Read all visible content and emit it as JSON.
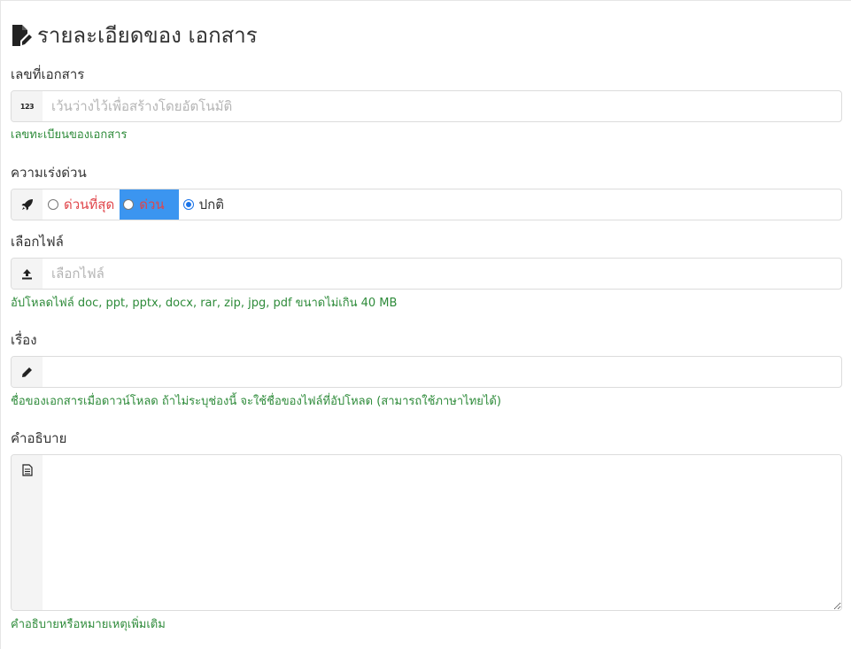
{
  "page": {
    "title": "รายละเอียดของ เอกสาร"
  },
  "doc_number": {
    "label": "เลขที่เอกสาร",
    "icon_text": "123",
    "placeholder": "เว้นว่างไว้เพื่อสร้างโดยอัตโนมัติ",
    "value": "",
    "help": "เลขทะเบียนของเอกสาร"
  },
  "urgency": {
    "label": "ความเร่งด่วน",
    "options": [
      {
        "label": "ด่วนที่สุด",
        "checked": false
      },
      {
        "label": "ด่วน",
        "checked": false
      },
      {
        "label": "ปกติ",
        "checked": true
      }
    ]
  },
  "file": {
    "label": "เลือกไฟล์",
    "placeholder": "เลือกไฟล์",
    "value": "",
    "help": "อัปโหลดไฟล์ doc, ppt, pptx, docx, rar, zip, jpg, pdf ขนาดไม่เกิน 40 MB"
  },
  "subject": {
    "label": "เรื่อง",
    "value": "",
    "help": "ชื่อของเอกสารเมื่อดาวน์โหลด ถ้าไม่ระบุช่องนี้ จะใช้ชื่อของไฟล์ที่อัปโหลด (สามารถใช้ภาษาไทยได้)"
  },
  "description": {
    "label": "คำอธิบาย",
    "value": "",
    "help": "คำอธิบายหรือหมายเหตุเพิ่มเติม"
  },
  "colors": {
    "help_text": "#2e8b3a",
    "urgent_text": "#e0454a",
    "highlight": "#3b95f0",
    "radio_checked": "#1a73e8"
  }
}
